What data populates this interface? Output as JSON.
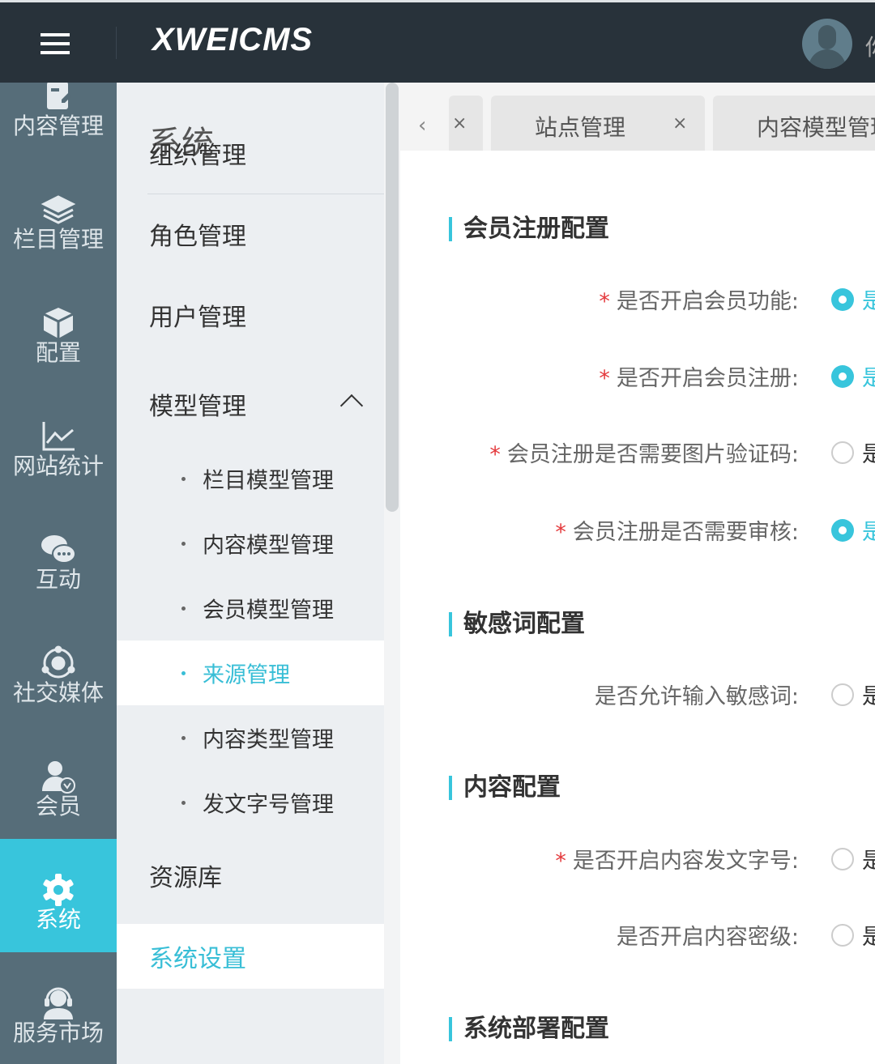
{
  "header": {
    "logo": "XWEICMS",
    "user_name_partial": "你"
  },
  "side_nav": [
    {
      "label": "内容管理",
      "icon": "document-edit-icon"
    },
    {
      "label": "栏目管理",
      "icon": "layers-icon"
    },
    {
      "label": "配置",
      "icon": "cube-icon"
    },
    {
      "label": "网站统计",
      "icon": "line-chart-icon"
    },
    {
      "label": "互动",
      "icon": "chat-bubbles-icon"
    },
    {
      "label": "社交媒体",
      "icon": "social-circle-icon"
    },
    {
      "label": "会员",
      "icon": "user-check-icon"
    },
    {
      "label": "系统",
      "icon": "gear-icon",
      "active": true
    },
    {
      "label": "服务市场",
      "icon": "headset-icon"
    }
  ],
  "sub_nav": {
    "title": "系统",
    "items": [
      {
        "label": "组织管理"
      },
      {
        "label": "角色管理"
      },
      {
        "label": "用户管理"
      },
      {
        "label": "模型管理",
        "expanded": true
      },
      {
        "label": "栏目模型管理",
        "sub": true
      },
      {
        "label": "内容模型管理",
        "sub": true
      },
      {
        "label": "会员模型管理",
        "sub": true
      },
      {
        "label": "来源管理",
        "sub": true,
        "active": true
      },
      {
        "label": "内容类型管理",
        "sub": true
      },
      {
        "label": "发文字号管理",
        "sub": true
      },
      {
        "label": "资源库"
      },
      {
        "label": "系统设置",
        "active": true
      }
    ]
  },
  "tabs": [
    {
      "label": "",
      "close": "×"
    },
    {
      "label": "站点管理",
      "close": "×"
    },
    {
      "label": "内容模型管理",
      "close": "×"
    }
  ],
  "form": {
    "sections": [
      {
        "title": "会员注册配置"
      },
      {
        "title": "敏感词配置"
      },
      {
        "title": "内容配置"
      },
      {
        "title": "系统部署配置"
      }
    ],
    "rows": [
      {
        "label": "是否开启会员功能:",
        "required": true,
        "option": "是",
        "checked": true
      },
      {
        "label": "是否开启会员注册:",
        "required": true,
        "option": "是",
        "checked": true
      },
      {
        "label": "会员注册是否需要图片验证码:",
        "required": true,
        "option": "是",
        "checked": false
      },
      {
        "label": "会员注册是否需要审核:",
        "required": true,
        "option": "是",
        "checked": true
      },
      {
        "label": "是否允许输入敏感词:",
        "required": false,
        "option": "是",
        "checked": false
      },
      {
        "label": "是否开启内容发文字号:",
        "required": true,
        "option": "是",
        "checked": false
      },
      {
        "label": "是否开启内容密级:",
        "required": false,
        "option": "是",
        "checked": false
      }
    ],
    "required_mark": "*"
  },
  "colors": {
    "accent": "#38c5dc",
    "header": "#28323a",
    "sidebar": "#566d79",
    "required": "#e4393c"
  }
}
